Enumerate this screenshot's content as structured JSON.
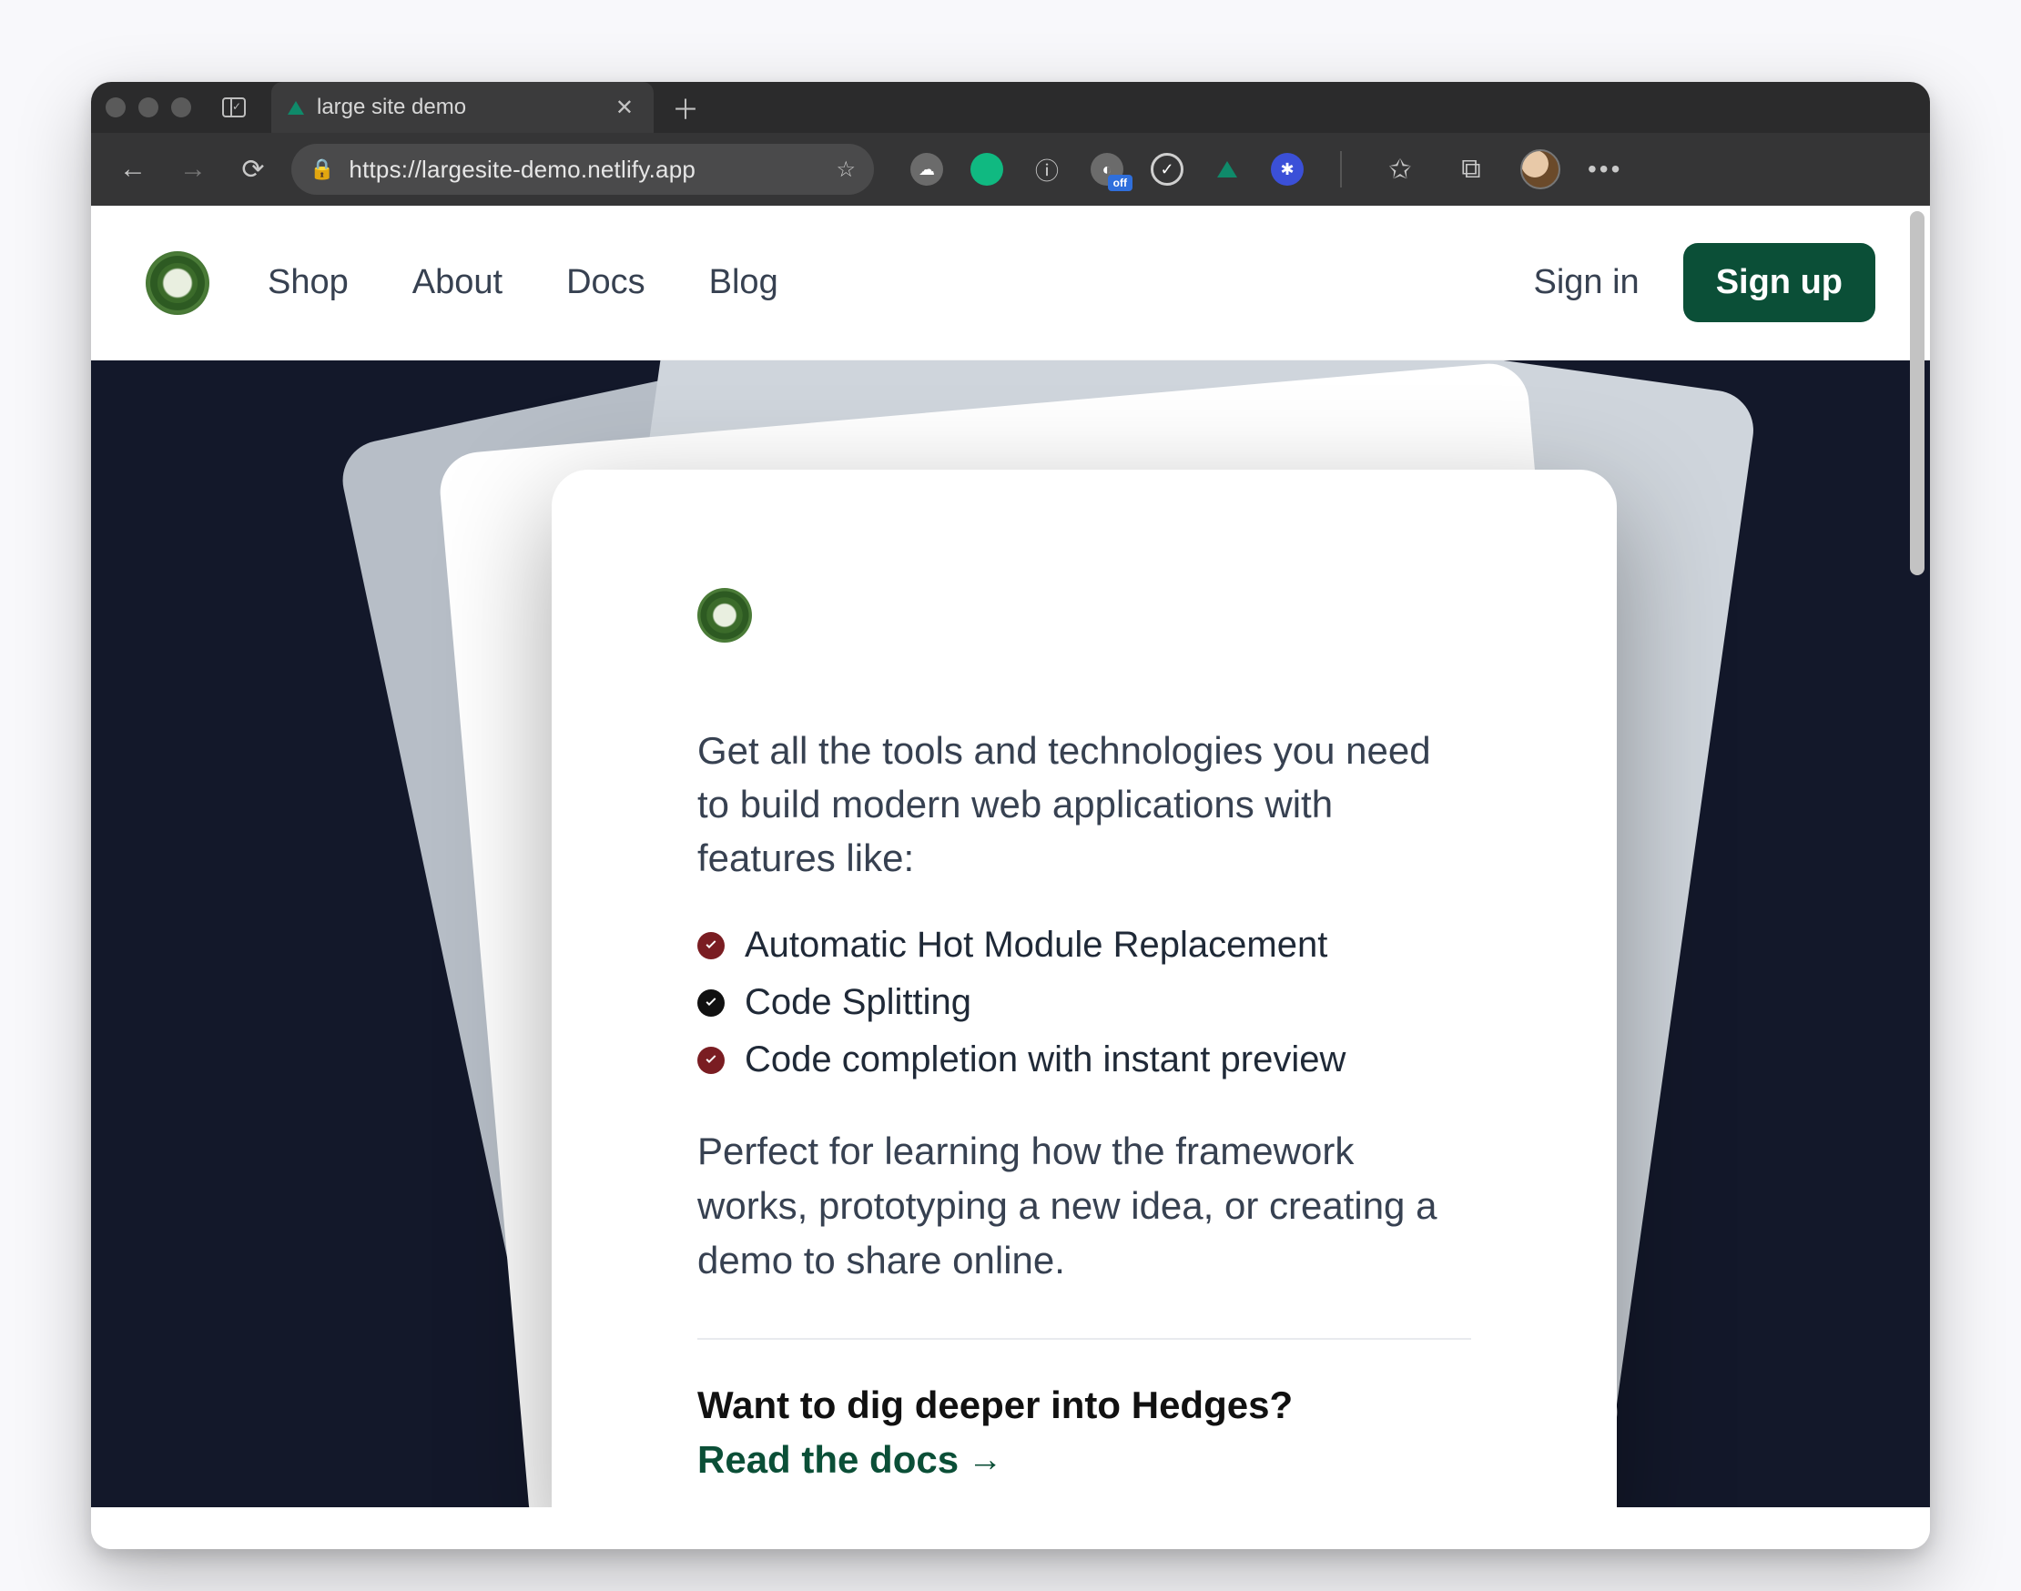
{
  "browser": {
    "tab_title": "large site demo",
    "url": "https://largesite-demo.netlify.app",
    "ext_badge": "off"
  },
  "site": {
    "nav": {
      "shop": "Shop",
      "about": "About",
      "docs": "Docs",
      "blog": "Blog"
    },
    "auth": {
      "signin": "Sign in",
      "signup": "Sign up"
    }
  },
  "hero": {
    "lead": "Get all the tools and technologies you need to build modern web applications with features like:",
    "features": {
      "f1": "Automatic Hot Module Replacement",
      "f2": "Code Splitting",
      "f3": "Code completion with instant preview"
    },
    "paragraph": "Perfect for learning how the framework works, prototyping a new idea, or creating a demo to share online.",
    "deeper": "Want to dig deeper into Hedges?",
    "docs_link": "Read the docs",
    "docs_arrow": "→"
  }
}
